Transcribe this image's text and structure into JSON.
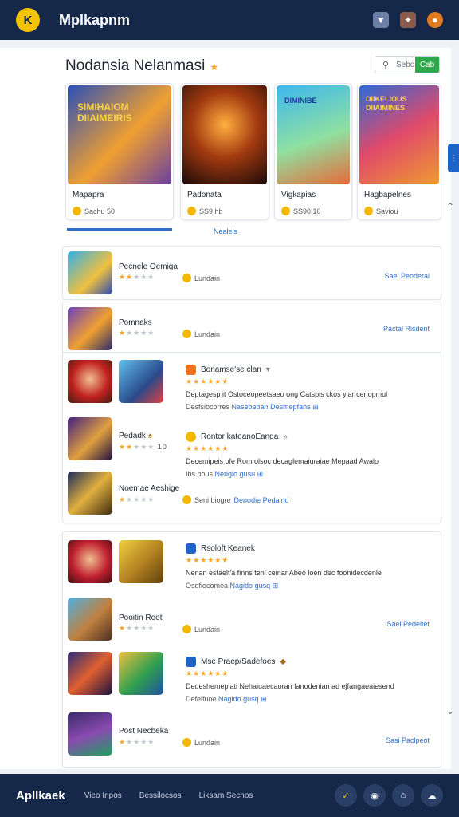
{
  "header": {
    "logo_letter": "K",
    "app_title": "Mplkapnm",
    "icons": [
      "filter-icon",
      "puzzle-icon",
      "leaf-icon"
    ]
  },
  "section": {
    "title": "Nodansia Nelanmasi",
    "search_placeholder": "Sebo",
    "search_button": "Cab",
    "more_link": "Nealels"
  },
  "featured": [
    {
      "banner": "SIMIHAIOM DIIAIMEIRIS",
      "name": "Mapapra",
      "price": "Sachu 50"
    },
    {
      "banner": "",
      "name": "Padonata",
      "price": "SS9 hb"
    },
    {
      "banner": "DIMINIBE",
      "name": "Vigkapias",
      "price": "SS90 10"
    },
    {
      "banner": "DIIKELIOUS DIIAIMINES",
      "name": "Hagbapelnes",
      "price": "Saviou"
    }
  ],
  "list1": [
    {
      "name": "Pecnele Oemiga",
      "stars": 2,
      "meta": "Lundain",
      "action": "Saei Peoderal"
    },
    {
      "name": "Pomnaks",
      "stars": 1,
      "meta": "Lundain",
      "action": "Pactal Risdent"
    }
  ],
  "list2": {
    "detail1": {
      "title": "Bonamse'se clan",
      "stars": 5,
      "desc": "Deptagesp it Ostoceopeetsaeo ong Catspis ckos ylar cenopmul",
      "link_prefix": "Desfsiocorres",
      "link": "Nasebeban Desmepfans"
    },
    "detail2": {
      "title": "Rontor kateanoEanga",
      "stars": 5,
      "desc": "Decemipeis ofe Rom olsoc decaglemaiuraiae Mepaad Awalo",
      "link_prefix": "Ibs bous",
      "link": "Nerigio gusu"
    },
    "games": [
      {
        "name": "Pedadk",
        "stars": 2,
        "meta": "10"
      },
      {
        "name": "Noemae Aeshige",
        "stars": 1,
        "meta": "Seni biogre",
        "meta_link": "Denodie Pedaind"
      }
    ]
  },
  "list3": {
    "detail1": {
      "title": "Rsoloft Keanek",
      "stars": 5,
      "desc": "Nenan estaelt'a finns tenl ceinar Abeo loen dec foonidecdenle",
      "link_prefix": "Osdfiocomea",
      "link": "Nagido gusq"
    },
    "game1": {
      "name": "Pooitin Root",
      "stars": 1,
      "meta": "Lundain",
      "action": "Saei Pedeltet"
    },
    "detail2": {
      "title": "Mse Praep/Sadefoes",
      "stars": 5,
      "desc": "Dedeshemeplati Nehaiuaecaoran fanodenian ad ejfangaeaiesend",
      "link_prefix": "Defelfuoe",
      "link": "Nagido gusq"
    },
    "game2": {
      "name": "Post Necbeka",
      "stars": 1,
      "meta": "Lundain",
      "action": "Sasi Paclpeot"
    }
  },
  "footer": {
    "brand": "Apllkaek",
    "nav": [
      "Vieo Inpos",
      "Bessilocsos",
      "Liksam Sechos"
    ],
    "buttons": [
      "check-icon",
      "chat-icon",
      "home-icon",
      "cloud-icon"
    ]
  },
  "colors": {
    "header_bg": "#16284a",
    "accent": "#2f6ec8",
    "star": "#f5a623",
    "green": "#2ea84b"
  }
}
